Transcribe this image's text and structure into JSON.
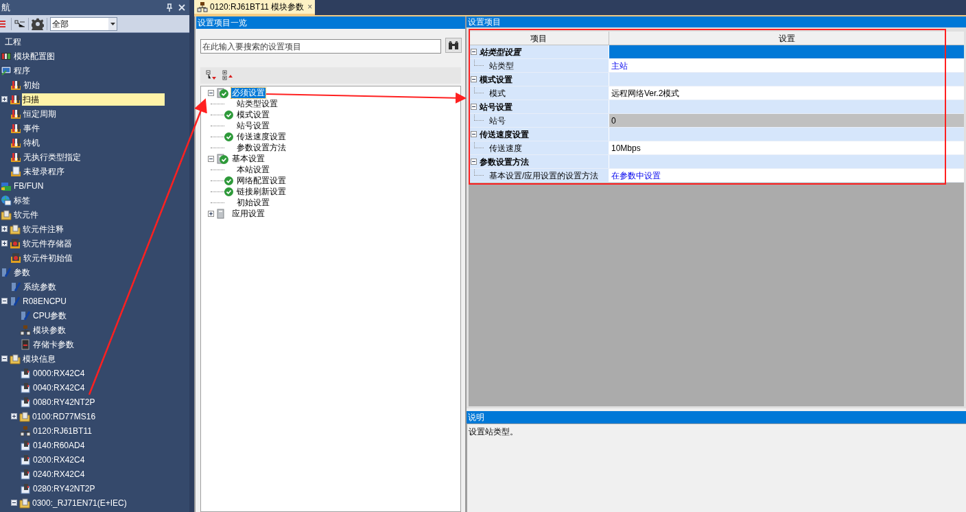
{
  "nav_panel": {
    "title": "航",
    "filter": {
      "value": "全部"
    },
    "tree": [
      {
        "label": "工程",
        "children": [
          {
            "label": "模块配置图",
            "kind": "diagram"
          },
          {
            "label": "程序",
            "kind": "programs",
            "children": [
              {
                "label": "初始",
                "kind": "program"
              },
              {
                "label": "扫描",
                "kind": "program",
                "expanded": false,
                "selected": true
              },
              {
                "label": "恒定周期",
                "kind": "program"
              },
              {
                "label": "事件",
                "kind": "program"
              },
              {
                "label": "待机",
                "kind": "program"
              },
              {
                "label": "无执行类型指定",
                "kind": "program"
              },
              {
                "label": "未登录程序",
                "kind": "document"
              }
            ]
          },
          {
            "label": "FB/FUN",
            "kind": "fb"
          },
          {
            "label": "标签",
            "kind": "label"
          },
          {
            "label": "软元件",
            "kind": "folder",
            "children": [
              {
                "label": "软元件注释",
                "kind": "folder",
                "expanded": false
              },
              {
                "label": "软元件存储器",
                "kind": "memory",
                "expanded": false
              },
              {
                "label": "软元件初始值",
                "kind": "memory"
              }
            ]
          },
          {
            "label": "参数",
            "kind": "param",
            "children": [
              {
                "label": "系统参数",
                "kind": "param"
              },
              {
                "label": "R08ENCPU",
                "kind": "param",
                "expanded": true,
                "children": [
                  {
                    "label": "CPU参数",
                    "kind": "param"
                  },
                  {
                    "label": "模块参数",
                    "kind": "network"
                  },
                  {
                    "label": "存储卡参数",
                    "kind": "card"
                  }
                ]
              },
              {
                "label": "模块信息",
                "kind": "folder",
                "expanded": true,
                "children": [
                  {
                    "label": "0000:RX42C4",
                    "kind": "module"
                  },
                  {
                    "label": "0040:RX42C4",
                    "kind": "module"
                  },
                  {
                    "label": "0080:RY42NT2P",
                    "kind": "module"
                  },
                  {
                    "label": "0100:RD77MS16",
                    "kind": "folder",
                    "expanded": false
                  },
                  {
                    "label": "0120:RJ61BT11",
                    "kind": "network"
                  },
                  {
                    "label": "0140:R60AD4",
                    "kind": "module"
                  },
                  {
                    "label": "0200:RX42C4",
                    "kind": "module"
                  },
                  {
                    "label": "0240:RX42C4",
                    "kind": "module"
                  },
                  {
                    "label": "0280:RY42NT2P",
                    "kind": "module"
                  },
                  {
                    "label": "0300:_RJ71EN71(E+IEC)",
                    "kind": "folder",
                    "expanded": true
                  }
                ]
              }
            ]
          }
        ]
      }
    ]
  },
  "document_tab": {
    "title": "0120:RJ61BT11 模块参数",
    "close": "×"
  },
  "item_list": {
    "title": "设置项目一览",
    "search": {
      "placeholder": "在此输入要搜索的设置项目"
    },
    "tree": [
      {
        "label": "必须设置",
        "checked": true,
        "expanded": true,
        "selected": true,
        "children": [
          {
            "label": "站类型设置",
            "checked": false
          },
          {
            "label": "模式设置",
            "checked": true
          },
          {
            "label": "站号设置",
            "checked": false
          },
          {
            "label": "传送速度设置",
            "checked": true
          },
          {
            "label": "参数设置方法",
            "checked": false
          }
        ]
      },
      {
        "label": "基本设置",
        "checked": true,
        "expanded": true,
        "selected": false,
        "children": [
          {
            "label": "本站设置",
            "checked": false
          },
          {
            "label": "网络配置设置",
            "checked": true
          },
          {
            "label": "链接刷新设置",
            "checked": true
          },
          {
            "label": "初始设置",
            "checked": false
          }
        ]
      },
      {
        "label": "应用设置",
        "checked": false,
        "expanded": false,
        "selected": false
      }
    ]
  },
  "settings": {
    "title": "设置项目",
    "columns": [
      "项目",
      "设置"
    ],
    "groups": [
      {
        "name": "站类型设置",
        "expanded": true,
        "selected": true,
        "rows": [
          {
            "item": "站类型",
            "value": "主站",
            "kind": "link"
          }
        ]
      },
      {
        "name": "模式设置",
        "expanded": true,
        "selected": false,
        "rows": [
          {
            "item": "模式",
            "value": "远程网络Ver.2模式",
            "kind": "text"
          }
        ]
      },
      {
        "name": "站号设置",
        "expanded": true,
        "selected": false,
        "rows": [
          {
            "item": "站号",
            "value": "0",
            "kind": "disabled"
          }
        ]
      },
      {
        "name": "传送速度设置",
        "expanded": true,
        "selected": false,
        "rows": [
          {
            "item": "传送速度",
            "value": "10Mbps",
            "kind": "text"
          }
        ]
      },
      {
        "name": "参数设置方法",
        "expanded": true,
        "selected": false,
        "rows": [
          {
            "item": "基本设置/应用设置的设置方法",
            "value": "在参数中设置",
            "kind": "link"
          }
        ]
      }
    ]
  },
  "description": {
    "title": "说明",
    "text": "设置站类型。"
  }
}
